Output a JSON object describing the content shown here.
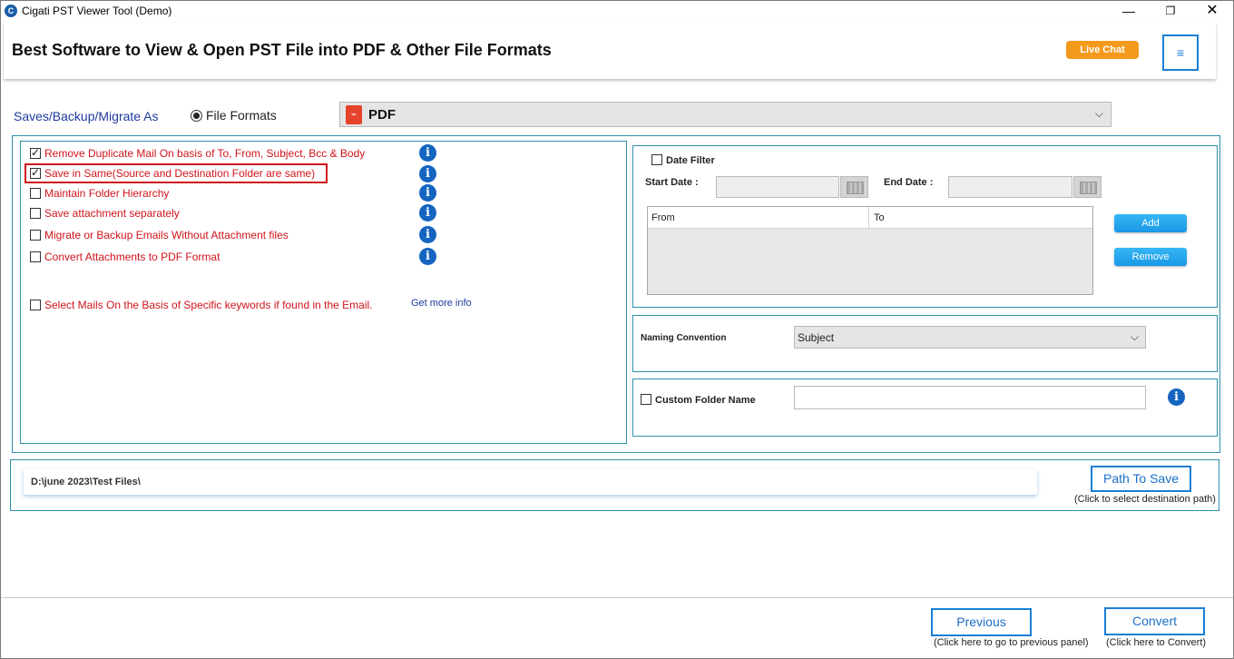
{
  "window": {
    "title": "Cigati PST Viewer Tool (Demo)",
    "minimize": "—",
    "maximize": "❐",
    "close": "✕"
  },
  "header": {
    "title": "Best Software to View & Open PST File into PDF & Other File Formats",
    "live_chat": "Live Chat",
    "menu_icon": "≡"
  },
  "saveas": {
    "label": "Saves/Backup/Migrate As",
    "radio_label": "File Formats",
    "format_value": "PDF"
  },
  "options": [
    {
      "label": "Remove Duplicate Mail On basis of To, From, Subject, Bcc & Body",
      "checked": true
    },
    {
      "label": "Save in Same(Source and Destination Folder are same)",
      "checked": true
    },
    {
      "label": "Maintain Folder Hierarchy",
      "checked": false
    },
    {
      "label": "Save attachment separately",
      "checked": false
    },
    {
      "label": "Migrate or Backup Emails Without Attachment files",
      "checked": false
    },
    {
      "label": "Convert Attachments to PDF Format",
      "checked": false
    }
  ],
  "keywords": {
    "label": "Select Mails On the Basis of Specific keywords if found in the Email.",
    "more_info": "Get more info"
  },
  "date_filter": {
    "label": "Date Filter",
    "start_label": "Start Date :",
    "end_label": "End Date :",
    "col_from": "From",
    "col_to": "To",
    "add": "Add",
    "remove": "Remove"
  },
  "naming": {
    "label": "Naming Convention",
    "value": "Subject"
  },
  "custom_folder": {
    "label": "Custom Folder Name",
    "value": ""
  },
  "path": {
    "value": "D:\\june 2023\\Test Files\\",
    "button": "Path To Save",
    "hint": "(Click to select destination path)"
  },
  "footer": {
    "previous": "Previous",
    "previous_hint": "(Click here to go to previous panel)",
    "convert": "Convert",
    "convert_hint": "(Click here to Convert)"
  },
  "colors": {
    "accent": "#1a7fd8",
    "option_text": "#d0141c",
    "label_blue": "#1d3a9e",
    "live_chat": "#f39a1d"
  }
}
